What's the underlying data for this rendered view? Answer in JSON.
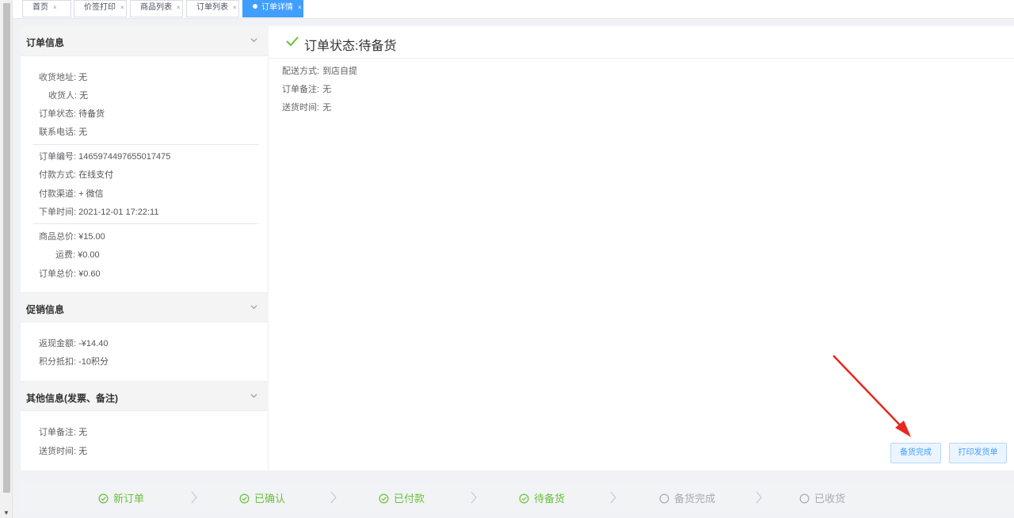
{
  "tabs": [
    {
      "label": "首页",
      "close": "×"
    },
    {
      "label": "价签打印",
      "close": "×"
    },
    {
      "label": "商品列表",
      "close": "×"
    },
    {
      "label": "订单列表",
      "close": "×"
    },
    {
      "label": "订单详情",
      "close": "×",
      "active": true
    }
  ],
  "order_info": {
    "title": "订单信息",
    "address_label": "收货地址:",
    "address": "无",
    "receiver_label": "收货人:",
    "receiver": "无",
    "status_label": "订单状态:",
    "status": "待备货",
    "phone_label": "联系电话:",
    "phone": "无",
    "order_no_label": "订单编号:",
    "order_no": "1465974497655017475",
    "pay_method_label": "付款方式:",
    "pay_method": "在线支付",
    "pay_channel_label": "付款渠道:",
    "pay_channel": "+ 微信",
    "order_time_label": "下单时间:",
    "order_time": "2021-12-01 17:22:11",
    "goods_total_label": "商品总价:",
    "goods_total": "¥15.00",
    "shipping_label": "运费:",
    "shipping": "¥0.00",
    "order_total_label": "订单总价:",
    "order_total": "¥0.60"
  },
  "promo_info": {
    "title": "促销信息",
    "cashback_label": "返现金额:",
    "cashback": "-¥14.40",
    "points_label": "积分抵扣:",
    "points": "-10积分"
  },
  "other_info": {
    "title": "其他信息(发票、备注)",
    "remark_label": "订单备注:",
    "remark": "无",
    "delivery_time_label": "送货时间:",
    "delivery_time": "无"
  },
  "status_panel": {
    "title": "订单状态:待备货",
    "delivery_method_label": "配送方式:",
    "delivery_method": "到店自提",
    "remark_label": "订单备注:",
    "remark": "无",
    "delivery_time_label": "送货时间:",
    "delivery_time": "无",
    "btn_prepared": "备货完成",
    "btn_print": "打印发货单"
  },
  "steps": [
    {
      "label": "新订单",
      "done": true
    },
    {
      "label": "已确认",
      "done": true
    },
    {
      "label": "已付款",
      "done": true
    },
    {
      "label": "待备货",
      "done": true
    },
    {
      "label": "备货完成",
      "done": false
    },
    {
      "label": "已收货",
      "done": false
    }
  ],
  "colors": {
    "accent": "#409eff",
    "success": "#67c23a",
    "pending": "#a8abb2",
    "annotation": "#e8281e"
  }
}
